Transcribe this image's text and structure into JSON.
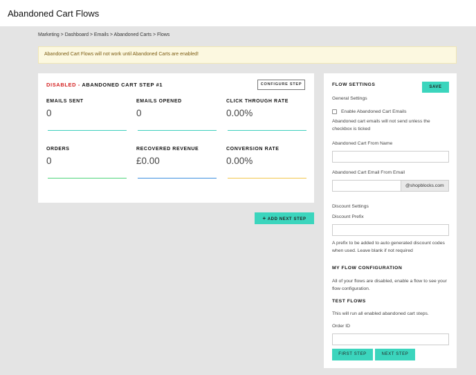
{
  "header": {
    "title": "Abandoned Cart Flows"
  },
  "breadcrumb": "Marketing > Dashboard > Emails > Abandoned Carts > Flows",
  "alert": "Abandoned Cart Flows will not work until Abandoned Carts are enabled!",
  "step": {
    "status": "DISABLED",
    "separator": " - ",
    "title": "ABANDONED CART STEP #1",
    "configure_label": "CONFIGURE STEP",
    "stats": [
      {
        "label": "EMAILS SENT",
        "value": "0",
        "color": "#3bcfbd"
      },
      {
        "label": "EMAILS OPENED",
        "value": "0",
        "color": "#3bcfbd"
      },
      {
        "label": "CLICK THROUGH RATE",
        "value": "0.00%",
        "color": "#3bcfbd"
      },
      {
        "label": "ORDERS",
        "value": "0",
        "color": "#4cd47a"
      },
      {
        "label": "RECOVERED REVENUE",
        "value": "£0.00",
        "color": "#3a8de0"
      },
      {
        "label": "CONVERSION RATE",
        "value": "0.00%",
        "color": "#f3c64a"
      }
    ]
  },
  "add_step_label": "ADD NEXT STEP",
  "settings": {
    "title": "FLOW SETTINGS",
    "save_label": "SAVE",
    "general_label": "General Settings",
    "enable_label": "Enable Abandoned Cart Emails",
    "enable_checked": false,
    "enable_help": "Abandoned cart emails will not send unless the checkbox is ticked",
    "from_name_label": "Abandoned Cart From Name",
    "from_name_value": "",
    "from_email_label": "Abandoned Cart Email From Email",
    "from_email_value": "",
    "from_email_domain": "@shopblocks.com",
    "discount_label": "Discount Settings",
    "prefix_label": "Discount Prefix",
    "prefix_value": "",
    "prefix_help": "A prefix to be added to auto generated discount codes when used. Leave blank if not required",
    "config_title": "MY FLOW CONFIGURATION",
    "config_text": "All of your flows are disabled, enable a flow to see your flow configuration.",
    "test_title": "TEST FLOWS",
    "test_text": "This will run all enabled abandoned cart steps.",
    "order_id_label": "Order ID",
    "order_id_value": "",
    "first_step_label": "FIRST STEP",
    "next_step_label": "NEXT STEP"
  },
  "colors": {
    "accent": "#3bd5bd",
    "danger": "#d42020",
    "alert_bg": "#fcf8e0"
  }
}
